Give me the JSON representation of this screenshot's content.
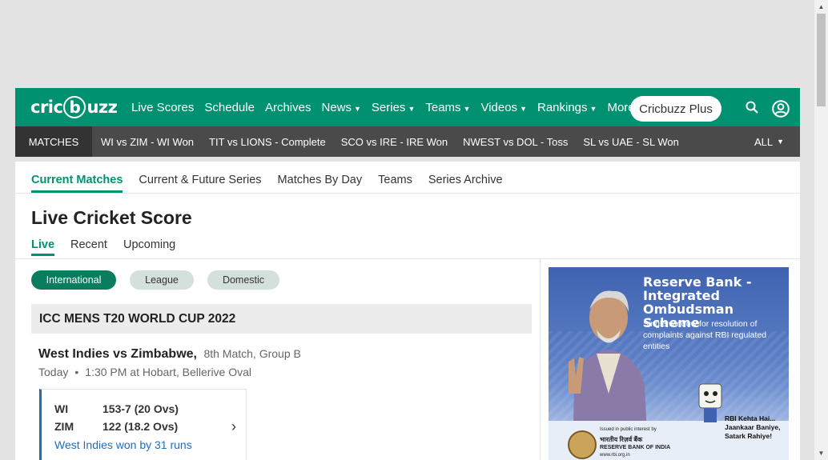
{
  "nav": {
    "logo": "cricbuzz",
    "links": [
      {
        "label": "Live Scores",
        "caret": false
      },
      {
        "label": "Schedule",
        "caret": false
      },
      {
        "label": "Archives",
        "caret": false
      },
      {
        "label": "News",
        "caret": true
      },
      {
        "label": "Series",
        "caret": true
      },
      {
        "label": "Teams",
        "caret": true
      },
      {
        "label": "Videos",
        "caret": true
      },
      {
        "label": "Rankings",
        "caret": true
      },
      {
        "label": "More",
        "caret": true
      }
    ],
    "plus_label": "Cricbuzz Plus",
    "icons": [
      "search-icon",
      "user-icon"
    ],
    "colors": {
      "brand": "#009270"
    }
  },
  "matchbar": {
    "label": "MATCHES",
    "items": [
      "WI vs ZIM - WI Won",
      "TIT vs LIONS - Complete",
      "SCO vs IRE - IRE Won",
      "NWEST vs DOL - Toss",
      "SL vs UAE - SL Won"
    ],
    "all_label": "ALL"
  },
  "subtabs": [
    "Current Matches",
    "Current & Future Series",
    "Matches By Day",
    "Teams",
    "Series Archive"
  ],
  "page_title": "Live Cricket Score",
  "live_tabs": [
    "Live",
    "Recent",
    "Upcoming"
  ],
  "filters": [
    "International",
    "League",
    "Domestic"
  ],
  "series": {
    "name": "ICC MENS T20 WORLD CUP 2022",
    "match": {
      "title": "West Indies vs Zimbabwe,",
      "subtitle": "8th Match, Group B",
      "day": "Today",
      "time_venue": "1:30 PM at Hobart, Bellerive Oval",
      "teams": [
        {
          "code": "WI",
          "score": "153-7 (20 Ovs)"
        },
        {
          "code": "ZIM",
          "score": "122 (18.2 Ovs)"
        }
      ],
      "result": "West Indies won by 31 runs",
      "result_color": "#1e6fb8"
    }
  },
  "ad": {
    "title": "Reserve Bank - Integrated Ombudsman Scheme",
    "subtitle": "Single window for resolution of complaints against RBI regulated entities",
    "issued": "Issued in public interest by",
    "bank_hindi": "भारतीय रिज़र्व बैंक",
    "bank_en": "RESERVE BANK OF INDIA",
    "url": "www.rbi.org.in",
    "tagline": "RBI Kehta Hai... Jaankaar Baniye, Satark Rahiye!"
  }
}
